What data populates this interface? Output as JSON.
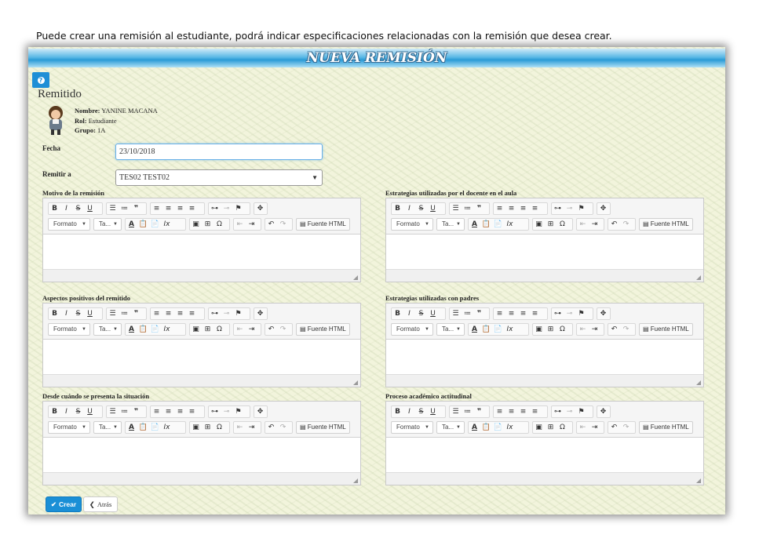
{
  "doc_intro": "Puede crear una remisión al estudiante, podrá indicar especificaciones relacionadas con la remisión que desea crear.",
  "window_title": "NUEVA REMISIÓN",
  "section_title": "Remitido",
  "user": {
    "name_label": "Nombre:",
    "name": "YANINE MACANA",
    "role_label": "Rol:",
    "role": "Estudiante",
    "group_label": "Grupo:",
    "group": "1A"
  },
  "form": {
    "date_label": "Fecha",
    "date_value": "23/10/2018",
    "remit_label": "Remitir a",
    "remit_value": "TES02 TEST02"
  },
  "editors": [
    {
      "label": "Motivo de la remisión"
    },
    {
      "label": "Estrategias utilizadas por el docente en el aula"
    },
    {
      "label": "Aspectos positivos del remitido"
    },
    {
      "label": "Estrategias utilizadas con padres"
    },
    {
      "label": "Desde cuándo se presenta la situación"
    },
    {
      "label": "Proceso académico actitudinal"
    }
  ],
  "toolbar": {
    "format_label": "Formato",
    "size_label": "Ta...",
    "source_label": "Fuente HTML"
  },
  "buttons": {
    "create": "Crear",
    "back": "Atrás"
  },
  "colors": {
    "accent": "#1a8fd6",
    "title_bar": "#2a9bd6",
    "background": "#f2f4dc"
  }
}
